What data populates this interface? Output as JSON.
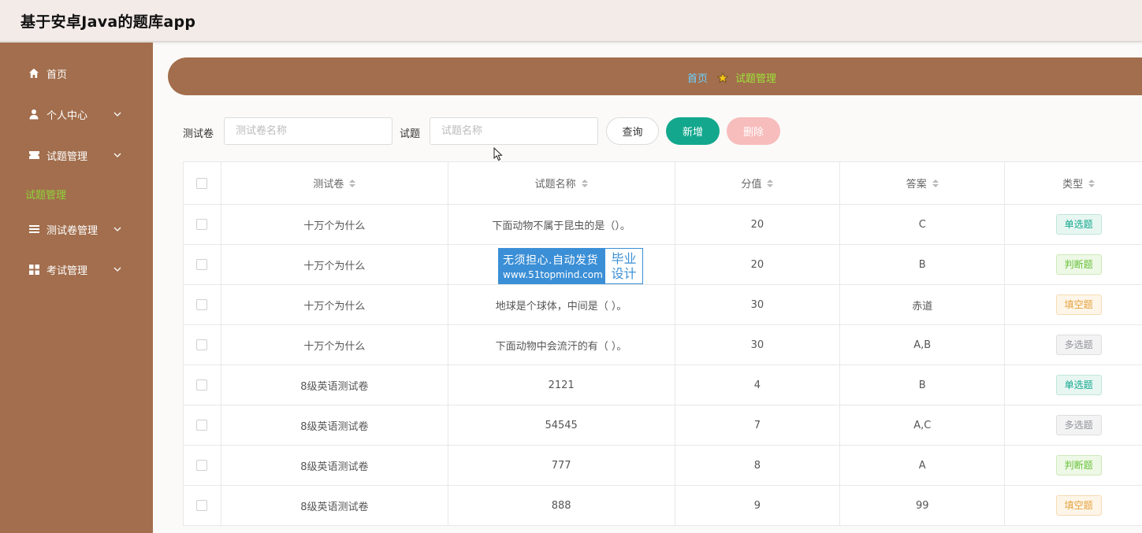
{
  "app": {
    "title": "基于安卓Java的题库app"
  },
  "sidebar": {
    "items": [
      {
        "label": "首页",
        "icon": "home-icon"
      },
      {
        "label": "个人中心",
        "icon": "user-icon"
      },
      {
        "label": "试题管理",
        "icon": "ticket-icon"
      },
      {
        "label": "测试卷管理",
        "icon": "list-icon"
      },
      {
        "label": "考试管理",
        "icon": "grid-icon"
      }
    ],
    "sub_item": "试题管理"
  },
  "breadcrumb": {
    "home": "首页",
    "current": "试题管理"
  },
  "filters": {
    "paper_label": "测试卷",
    "paper_placeholder": "测试卷名称",
    "question_label": "试题",
    "question_placeholder": "试题名称"
  },
  "buttons": {
    "query": "查询",
    "add": "新增",
    "delete": "删除"
  },
  "table": {
    "columns": [
      "测试卷",
      "试题名称",
      "分值",
      "答案",
      "类型"
    ],
    "rows": [
      {
        "paper": "十万个为什么",
        "question": "下面动物不属于昆虫的是（）。",
        "score": "20",
        "answer": "C",
        "type": "单选题",
        "type_kind": "single"
      },
      {
        "paper": "十万个为什么",
        "question": "",
        "score": "20",
        "answer": "B",
        "type": "判断题",
        "type_kind": "judge"
      },
      {
        "paper": "十万个为什么",
        "question": "地球是个球体，中间是（ ）。",
        "score": "30",
        "answer": "赤道",
        "type": "填空题",
        "type_kind": "fill"
      },
      {
        "paper": "十万个为什么",
        "question": "下面动物中会流汗的有（ ）。",
        "score": "30",
        "answer": "A,B",
        "type": "多选题",
        "type_kind": "multi"
      },
      {
        "paper": "8级英语测试卷",
        "question": "2121",
        "score": "4",
        "answer": "B",
        "type": "单选题",
        "type_kind": "single"
      },
      {
        "paper": "8级英语测试卷",
        "question": "54545",
        "score": "7",
        "answer": "A,C",
        "type": "多选题",
        "type_kind": "multi"
      },
      {
        "paper": "8级英语测试卷",
        "question": "777",
        "score": "8",
        "answer": "A",
        "type": "判断题",
        "type_kind": "judge"
      },
      {
        "paper": "8级英语测试卷",
        "question": "888",
        "score": "9",
        "answer": "99",
        "type": "填空题",
        "type_kind": "fill"
      }
    ]
  },
  "watermark": {
    "line1": "无须担心.自动发货",
    "line2": "www.51topmind.com",
    "right_top": "毕业",
    "right_bottom": "设计"
  },
  "colors": {
    "sidebar": "#a26e4d",
    "accent": "#13a88d",
    "danger_light": "#f7bcbc",
    "active_green": "#9ee33a"
  }
}
